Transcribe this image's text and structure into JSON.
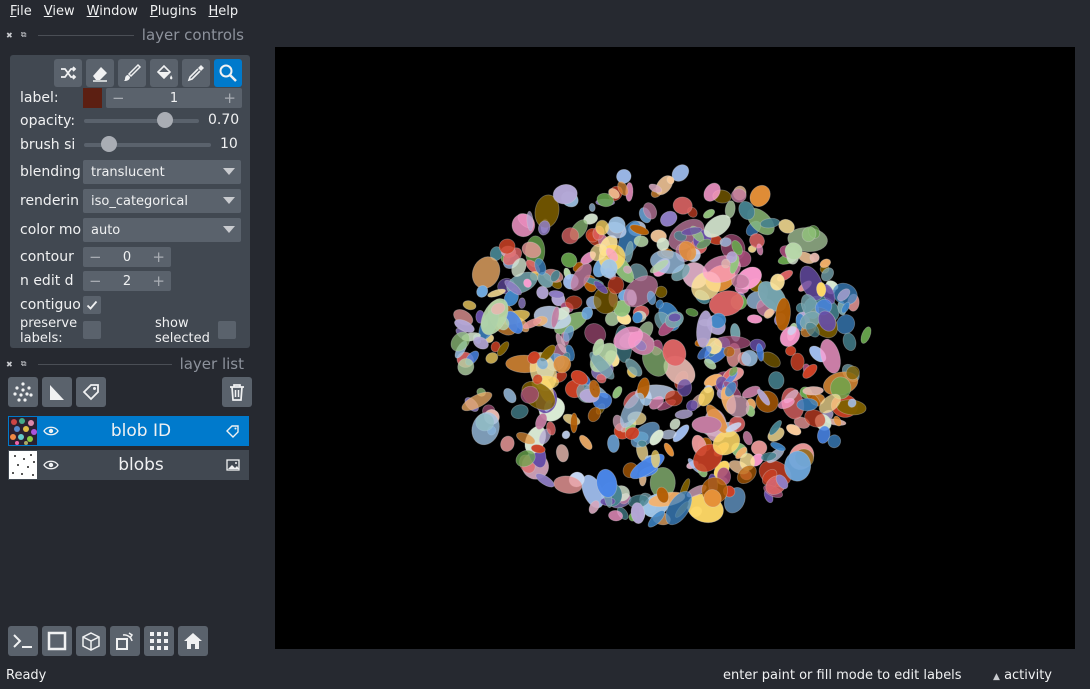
{
  "menu": [
    {
      "mnemonic": "F",
      "rest": "ile"
    },
    {
      "mnemonic": "V",
      "rest": "iew"
    },
    {
      "mnemonic": "W",
      "rest": "indow"
    },
    {
      "mnemonic": "P",
      "rest": "lugins"
    },
    {
      "mnemonic": "H",
      "rest": "elp"
    }
  ],
  "layer_controls": {
    "title": "layer controls",
    "label": {
      "text": "label:",
      "value": "1",
      "color": "#5c1f12"
    },
    "opacity": {
      "text": "opacity:",
      "value": "0.70",
      "fraction": 0.7
    },
    "brush_size": {
      "text": "brush si",
      "value": "10",
      "fraction": 0.2
    },
    "blending": {
      "text": "blending",
      "value": "translucent"
    },
    "rendering": {
      "text": "renderin",
      "value": "iso_categorical"
    },
    "color_mode": {
      "text": "color mo",
      "value": "auto"
    },
    "contour": {
      "text": "contour",
      "value": "0"
    },
    "n_edit_dim": {
      "text": "n edit d",
      "value": "2"
    },
    "contiguous": {
      "text": "contiguo",
      "checked": true
    },
    "preserve_labels": {
      "text": "preserve\nlabels:",
      "checked": false
    },
    "show_selected": {
      "text": "show\nselected",
      "checked": false
    }
  },
  "layer_list": {
    "title": "layer list",
    "layers": [
      {
        "name": "blob ID",
        "selected": true,
        "type_icon": "labels-tag-icon"
      },
      {
        "name": "blobs",
        "selected": false,
        "type_icon": "image-icon"
      }
    ]
  },
  "status": {
    "left": "Ready",
    "hint": "enter paint or fill mode to edit labels",
    "activity": "activity"
  },
  "colors": {
    "accent": "#007acc",
    "panel": "#414851",
    "background": "#262930",
    "button": "#5a626c"
  }
}
